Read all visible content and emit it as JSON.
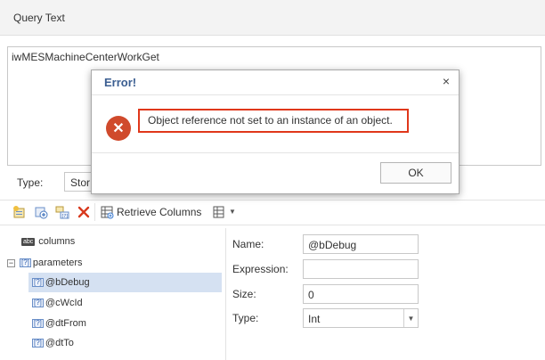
{
  "header": {
    "title": "Query Text"
  },
  "query": {
    "text": "iwMESMachineCenterWorkGet"
  },
  "type_row": {
    "label": "Type:",
    "value": "Stor"
  },
  "toolbar": {
    "retrieve_label": "Retrieve Columns",
    "icons": [
      "add-icon",
      "add-param-icon",
      "param-icon",
      "delete-icon",
      "retrieve-columns-icon",
      "more-options-icon"
    ]
  },
  "tree": {
    "columns_label": "columns",
    "parameters_label": "parameters",
    "expand_symbol": "−",
    "param_badge": "[?]",
    "abc_badge": "abc",
    "items": [
      "@bDebug",
      "@cWcId",
      "@dtFrom",
      "@dtTo"
    ]
  },
  "properties": {
    "name_label": "Name:",
    "name_value": "@bDebug",
    "expression_label": "Expression:",
    "expression_value": "",
    "size_label": "Size:",
    "size_value": "0",
    "type_label": "Type:",
    "type_value": "Int"
  },
  "dialog": {
    "title": "Error!",
    "close_symbol": "×",
    "message": "Object reference not set to an instance of an object.",
    "ok_label": "OK",
    "colors": {
      "title": "#3b5e91",
      "error_icon": "#d04a2c",
      "highlight_border": "#e0371b"
    }
  }
}
